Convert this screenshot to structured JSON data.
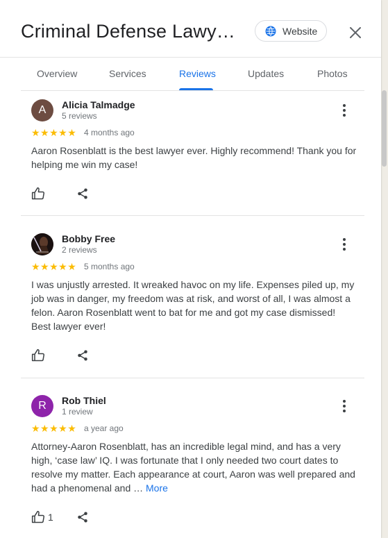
{
  "header": {
    "title": "Criminal Defense Lawy…",
    "website_label": "Website"
  },
  "tabs": [
    {
      "label": "Overview",
      "active": false
    },
    {
      "label": "Services",
      "active": false
    },
    {
      "label": "Reviews",
      "active": true
    },
    {
      "label": "Updates",
      "active": false
    },
    {
      "label": "Photos",
      "active": false
    }
  ],
  "reviews": [
    {
      "avatar_letter": "A",
      "avatar_color": "#6d4c41",
      "name": "Alicia Talmadge",
      "count": "5 reviews",
      "stars": "★★★★★",
      "rating": 5,
      "age": "4 months ago",
      "text": "Aaron Rosenblatt is the best lawyer ever. Highly recommend! Thank you for helping me win my case!",
      "likes": ""
    },
    {
      "avatar_letter": "",
      "avatar_color": "#2b1a18",
      "name": "Bobby Free",
      "count": "2 reviews",
      "stars": "★★★★★",
      "rating": 5,
      "age": "5 months ago",
      "text": "I was unjustly arrested. It wreaked havoc on my life. Expenses piled up, my job was in danger, my freedom was at risk, and worst of all, I was almost a felon. Aaron Rosenblatt went to bat for me and got my case dismissed! Best lawyer ever!",
      "likes": ""
    },
    {
      "avatar_letter": "R",
      "avatar_color": "#8e24aa",
      "name": "Rob Thiel",
      "count": "1 review",
      "stars": "★★★★★",
      "rating": 5,
      "age": "a year ago",
      "text": "Attorney-Aaron Rosenblatt, has an incredible legal mind, and has a very high, ‘case law’ IQ. I was fortunate that I only needed two court dates to resolve my matter. Each appearance at court, Aaron was well prepared and had a phenomenal and … ",
      "more": "More",
      "likes": "1"
    }
  ],
  "colors": {
    "accent": "#1a73e8",
    "star": "#fbbc04"
  }
}
